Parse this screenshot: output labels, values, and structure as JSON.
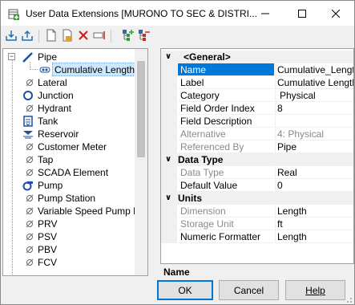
{
  "window": {
    "title": "User Data Extensions [MURONO TO SEC & DISTRI...",
    "icon": "add-table-icon",
    "controls": [
      "minimize-icon",
      "maximize-icon",
      "close-icon"
    ]
  },
  "toolbar": {
    "tools": [
      "import-icon",
      "export-icon",
      "new-icon",
      "open-icon",
      "delete-icon",
      "rename-icon",
      "expand-all-icon",
      "collapse-all-icon"
    ]
  },
  "tree": {
    "items": [
      {
        "label": "Pipe",
        "icon": "pipe-icon",
        "expanded": true
      },
      {
        "label": "Cumulative Length",
        "icon": "field-icon",
        "selected": true
      },
      {
        "label": "Lateral",
        "icon": "lateral-icon"
      },
      {
        "label": "Junction",
        "icon": "junction-icon"
      },
      {
        "label": "Hydrant",
        "icon": "hydrant-icon"
      },
      {
        "label": "Tank",
        "icon": "tank-icon"
      },
      {
        "label": "Reservoir",
        "icon": "reservoir-icon"
      },
      {
        "label": "Customer Meter",
        "icon": "customer-meter-icon"
      },
      {
        "label": "Tap",
        "icon": "tap-icon"
      },
      {
        "label": "SCADA Element",
        "icon": "scada-icon"
      },
      {
        "label": "Pump",
        "icon": "pump-icon"
      },
      {
        "label": "Pump Station",
        "icon": "pump-station-icon"
      },
      {
        "label": "Variable Speed Pump Bat",
        "icon": "vspb-icon"
      },
      {
        "label": "PRV",
        "icon": "prv-icon"
      },
      {
        "label": "PSV",
        "icon": "psv-icon"
      },
      {
        "label": "PBV",
        "icon": "pbv-icon"
      },
      {
        "label": "FCV",
        "icon": "fcv-icon"
      }
    ]
  },
  "grid": {
    "rows": [
      {
        "type": "category",
        "label": "<General>"
      },
      {
        "name": "Name",
        "value": "Cumulative_Length",
        "selected": true
      },
      {
        "name": "Label",
        "value": "Cumulative Length"
      },
      {
        "name": "Category",
        "value": "Physical"
      },
      {
        "name": "Field Order Index",
        "value": "8"
      },
      {
        "name": "Field Description",
        "value": ""
      },
      {
        "name": "Alternative",
        "value": "4:  Physical",
        "disabled": true
      },
      {
        "name": "Referenced By",
        "value": "Pipe",
        "disabled": true
      },
      {
        "type": "category",
        "label": "Data Type"
      },
      {
        "name": "Data Type",
        "value": "Real",
        "disabled": true
      },
      {
        "name": "Default Value",
        "value": "0"
      },
      {
        "type": "category",
        "label": "Units"
      },
      {
        "name": "Dimension",
        "value": "Length",
        "disabled": true
      },
      {
        "name": "Storage Unit",
        "value": "ft",
        "disabled": true
      },
      {
        "name": "Numeric Formatter",
        "value": "Length"
      }
    ],
    "description_title": "Name"
  },
  "buttons": {
    "ok": "OK",
    "cancel": "Cancel",
    "help": "Help"
  }
}
